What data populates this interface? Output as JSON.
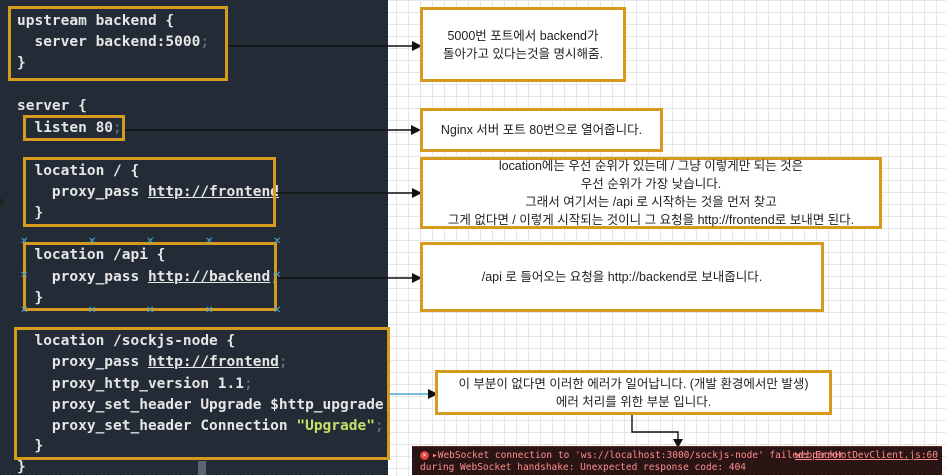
{
  "code": {
    "lines": [
      {
        "text": "upstream backend {"
      },
      {
        "text": "  server backend:5000"
      },
      {
        "text": "}"
      },
      {
        "text": "server {"
      },
      {
        "text": "  listen 80"
      },
      {
        "text": "  location / {"
      },
      {
        "text": "    proxy_pass ",
        "url": "http://frontend"
      },
      {
        "text": "  }"
      },
      {
        "text": "  location /api {"
      },
      {
        "text": "    proxy_pass ",
        "url": "http://backend"
      },
      {
        "text": "  }"
      },
      {
        "text": "  location /sockjs-node {"
      },
      {
        "text": "    proxy_pass ",
        "url": "http://frontend"
      },
      {
        "text": "    proxy_http_version 1.1"
      },
      {
        "text": "    proxy_set_header Upgrade $http_upgrade"
      },
      {
        "text": "    proxy_set_header Connection ",
        "str": "\"Upgrade\""
      },
      {
        "text": "  }"
      },
      {
        "text": "}"
      }
    ],
    "semicolon": ";"
  },
  "notes": {
    "upstream": [
      "5000번 포트에서 backend가",
      "돌아가고 있다는것을 명시해줌."
    ],
    "listen": [
      "Nginx 서버 포트 80번으로 열어줍니다."
    ],
    "location_root": [
      "location에는 우선 순위가 있는데 / 그냥 이렇게만 되는 것은",
      "우선 순위가 가장 낮습니다.",
      "그래서 여기서는 /api 로 시작하는 것을 먼저 찾고",
      "그게 없다면 / 이렇게 시작되는 것이니 그 요청을  http://frontend로 보내면 된다."
    ],
    "location_api": [
      "/api 로 들어오는 요청을 http://backend로 보내줍니다."
    ],
    "sockjs": [
      "이 부분이 없다면 이러한 에러가 일어납니다. (개발 환경에서만 발생)",
      "에러 처리를 위한 부분 입니다."
    ]
  },
  "console_error": {
    "line1": "WebSocket connection to 'ws://localhost:3000/sockjs-node' failed: Error",
    "line2": "during WebSocket handshake: Unexpected response code: 404",
    "source": "webpackHotDevClient.js:60"
  },
  "colors": {
    "highlight": "#d59a1e",
    "code_bg": "#232b36",
    "selection_handle": "#4ba6d6"
  }
}
